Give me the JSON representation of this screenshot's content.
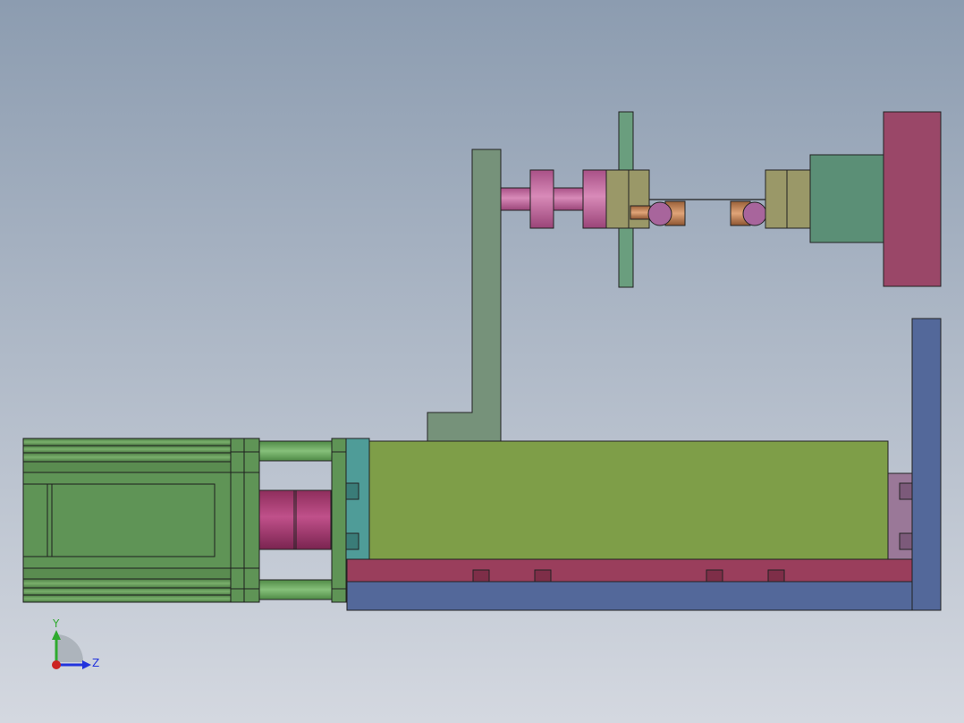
{
  "triad": {
    "y_label": "Y",
    "z_label": "Z",
    "y_color": "#2eaa2e",
    "z_color": "#2233dd",
    "x_color": "#cc2222"
  },
  "colors": {
    "bg_top": "#8c9cb0",
    "bg_bottom": "#d2d6de",
    "motor_green": "#5f9456",
    "rod_green": "#6ea864",
    "coupling_pink": "#b04478",
    "flange_teal": "#4f9c98",
    "body_olive": "#7e9e48",
    "rail_crimson": "#9a3e5c",
    "base_blue": "#53689a",
    "bracket_grey_green": "#76927a",
    "side_block_mauve": "#9a7898",
    "upper_pink": "#c66fa0",
    "clamp_khaki": "#9a9868",
    "pin_copper": "#c6875a",
    "ball_purple": "#a8659c",
    "holder_green": "#5b8f76",
    "plate_maroon": "#9a4768",
    "post_green": "#6a9e7e"
  }
}
